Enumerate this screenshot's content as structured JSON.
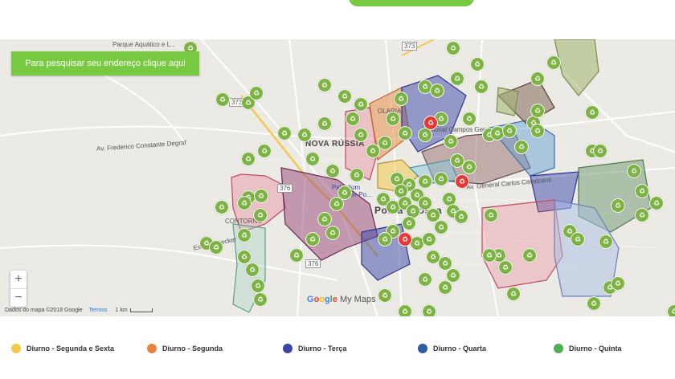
{
  "search_button": "Para pesquisar seu endereço clique aqui",
  "map": {
    "labels": {
      "parque": "Parque Aquático e L...",
      "nova_russia": "NOVA RÚSSIA",
      "contorno": "CONTORNO",
      "ponta_grossa": "Ponta Grossa",
      "palladium": "Palladium",
      "centro_ponta": "Center Po...",
      "olaria": "OLARIA",
      "av_frederico": "Av. Frederico Constante Degraf",
      "av_general": "Av. General Carlos Cavalcanti",
      "estrada": "Estrada Becker",
      "road_373": "373",
      "road_376": "376",
      "road_376b": "376",
      "road_373b": "373",
      "campo": "Nacional Campos Gerais"
    },
    "zoom_in": "+",
    "zoom_out": "−",
    "attribution": "Dados do mapa ©2018 Google",
    "terms": "Termos",
    "scale": "1 km",
    "logo": {
      "g1": "G",
      "g2": "o",
      "g3": "o",
      "g4": "g",
      "g5": "l",
      "g6": "e",
      "product": "My Maps"
    }
  },
  "legend": [
    {
      "label": "Diurno - Segunda e Sexta",
      "color": "#f2c94c"
    },
    {
      "label": "Diurno - Segunda",
      "color": "#e8853d"
    },
    {
      "label": "Diurno - Terça",
      "color": "#3a46a8"
    },
    {
      "label": "Diurno - Quarta",
      "color": "#2b5c9e"
    },
    {
      "label": "Diurno - Quinta",
      "color": "#4caf50"
    }
  ],
  "colors": {
    "accent": "#7ac943",
    "marker_green": "#7cb342",
    "marker_red": "#e53935"
  },
  "icons": {
    "marker": "recycle-icon",
    "marker_red": "recycle-alert-icon"
  }
}
